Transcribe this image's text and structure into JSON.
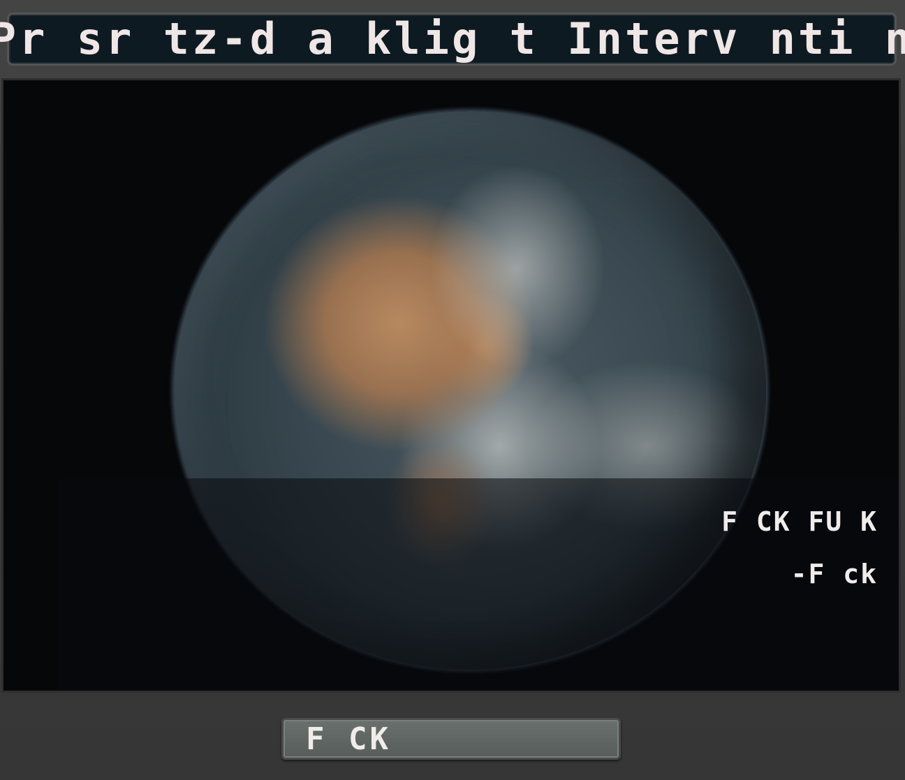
{
  "window": {
    "title": "Pr sr tz-d a klig t Interv nti n"
  },
  "viewport": {
    "image": "earth-from-space",
    "message_line1": "F CK FU K",
    "message_line2": "-F ck"
  },
  "action": {
    "button_label": "F CK"
  },
  "colors": {
    "text": "#f1ecec",
    "title_bar_bg": "#0e1a22",
    "viewport_bg": "#050709",
    "frame_bg": "#3b3b3b",
    "button_bg": "#5f6562"
  }
}
